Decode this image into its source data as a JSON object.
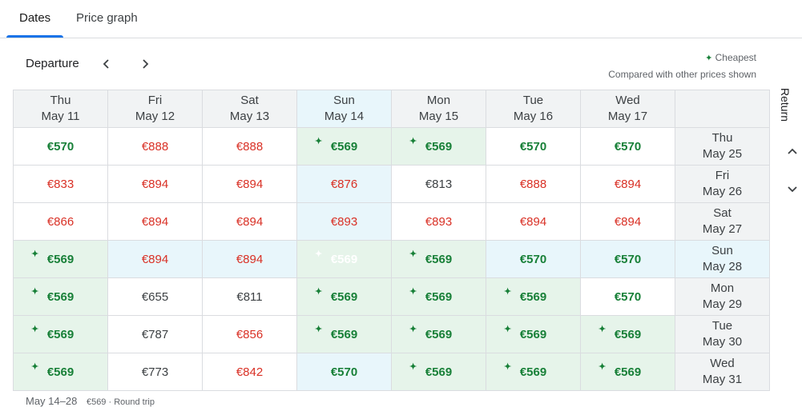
{
  "tabs": [
    {
      "label": "Dates"
    },
    {
      "label": "Price graph"
    }
  ],
  "departure": {
    "label": "Departure"
  },
  "legend": {
    "cheapest": "Cheapest",
    "note": "Compared with other prices shown"
  },
  "return_label": "Return",
  "columns": [
    {
      "day": "Thu",
      "date": "May 11"
    },
    {
      "day": "Fri",
      "date": "May 12"
    },
    {
      "day": "Sat",
      "date": "May 13"
    },
    {
      "day": "Sun",
      "date": "May 14"
    },
    {
      "day": "Mon",
      "date": "May 15"
    },
    {
      "day": "Tue",
      "date": "May 16"
    },
    {
      "day": "Wed",
      "date": "May 17"
    }
  ],
  "rows": [
    {
      "day": "Thu",
      "date": "May 25",
      "cells": [
        {
          "price": "€570",
          "color": "green"
        },
        {
          "price": "€888",
          "color": "red"
        },
        {
          "price": "€888",
          "color": "red"
        },
        {
          "price": "€569",
          "color": "green",
          "cheapest": true
        },
        {
          "price": "€569",
          "color": "green",
          "cheapest": true
        },
        {
          "price": "€570",
          "color": "green"
        },
        {
          "price": "€570",
          "color": "green"
        }
      ]
    },
    {
      "day": "Fri",
      "date": "May 26",
      "cells": [
        {
          "price": "€833",
          "color": "red"
        },
        {
          "price": "€894",
          "color": "red"
        },
        {
          "price": "€894",
          "color": "red"
        },
        {
          "price": "€876",
          "color": "red"
        },
        {
          "price": "€813",
          "color": "black"
        },
        {
          "price": "€888",
          "color": "red"
        },
        {
          "price": "€894",
          "color": "red"
        }
      ]
    },
    {
      "day": "Sat",
      "date": "May 27",
      "cells": [
        {
          "price": "€866",
          "color": "red"
        },
        {
          "price": "€894",
          "color": "red"
        },
        {
          "price": "€894",
          "color": "red"
        },
        {
          "price": "€893",
          "color": "red"
        },
        {
          "price": "€893",
          "color": "red"
        },
        {
          "price": "€894",
          "color": "red"
        },
        {
          "price": "€894",
          "color": "red"
        }
      ]
    },
    {
      "day": "Sun",
      "date": "May 28",
      "cells": [
        {
          "price": "€569",
          "color": "green",
          "cheapest": true
        },
        {
          "price": "€894",
          "color": "red"
        },
        {
          "price": "€894",
          "color": "red"
        },
        {
          "price": "€569",
          "color": "green",
          "cheapest": true,
          "selected": true
        },
        {
          "price": "€569",
          "color": "green",
          "cheapest": true
        },
        {
          "price": "€570",
          "color": "green"
        },
        {
          "price": "€570",
          "color": "green"
        }
      ]
    },
    {
      "day": "Mon",
      "date": "May 29",
      "cells": [
        {
          "price": "€569",
          "color": "green",
          "cheapest": true
        },
        {
          "price": "€655",
          "color": "black"
        },
        {
          "price": "€811",
          "color": "black"
        },
        {
          "price": "€569",
          "color": "green",
          "cheapest": true
        },
        {
          "price": "€569",
          "color": "green",
          "cheapest": true
        },
        {
          "price": "€569",
          "color": "green",
          "cheapest": true
        },
        {
          "price": "€570",
          "color": "green"
        }
      ]
    },
    {
      "day": "Tue",
      "date": "May 30",
      "cells": [
        {
          "price": "€569",
          "color": "green",
          "cheapest": true
        },
        {
          "price": "€787",
          "color": "black"
        },
        {
          "price": "€856",
          "color": "red"
        },
        {
          "price": "€569",
          "color": "green",
          "cheapest": true
        },
        {
          "price": "€569",
          "color": "green",
          "cheapest": true
        },
        {
          "price": "€569",
          "color": "green",
          "cheapest": true
        },
        {
          "price": "€569",
          "color": "green",
          "cheapest": true
        }
      ]
    },
    {
      "day": "Wed",
      "date": "May 31",
      "cells": [
        {
          "price": "€569",
          "color": "green",
          "cheapest": true
        },
        {
          "price": "€773",
          "color": "black"
        },
        {
          "price": "€842",
          "color": "red"
        },
        {
          "price": "€570",
          "color": "green"
        },
        {
          "price": "€569",
          "color": "green",
          "cheapest": true
        },
        {
          "price": "€569",
          "color": "green",
          "cheapest": true
        },
        {
          "price": "€569",
          "color": "green",
          "cheapest": true
        }
      ]
    }
  ],
  "footer": {
    "dates": "May 14–28",
    "summary": "€569 · Round trip"
  },
  "colors": {
    "accent": "#1a73e8",
    "cheap_bg": "#e6f4ea",
    "green": "#188038",
    "red": "#d93025"
  }
}
